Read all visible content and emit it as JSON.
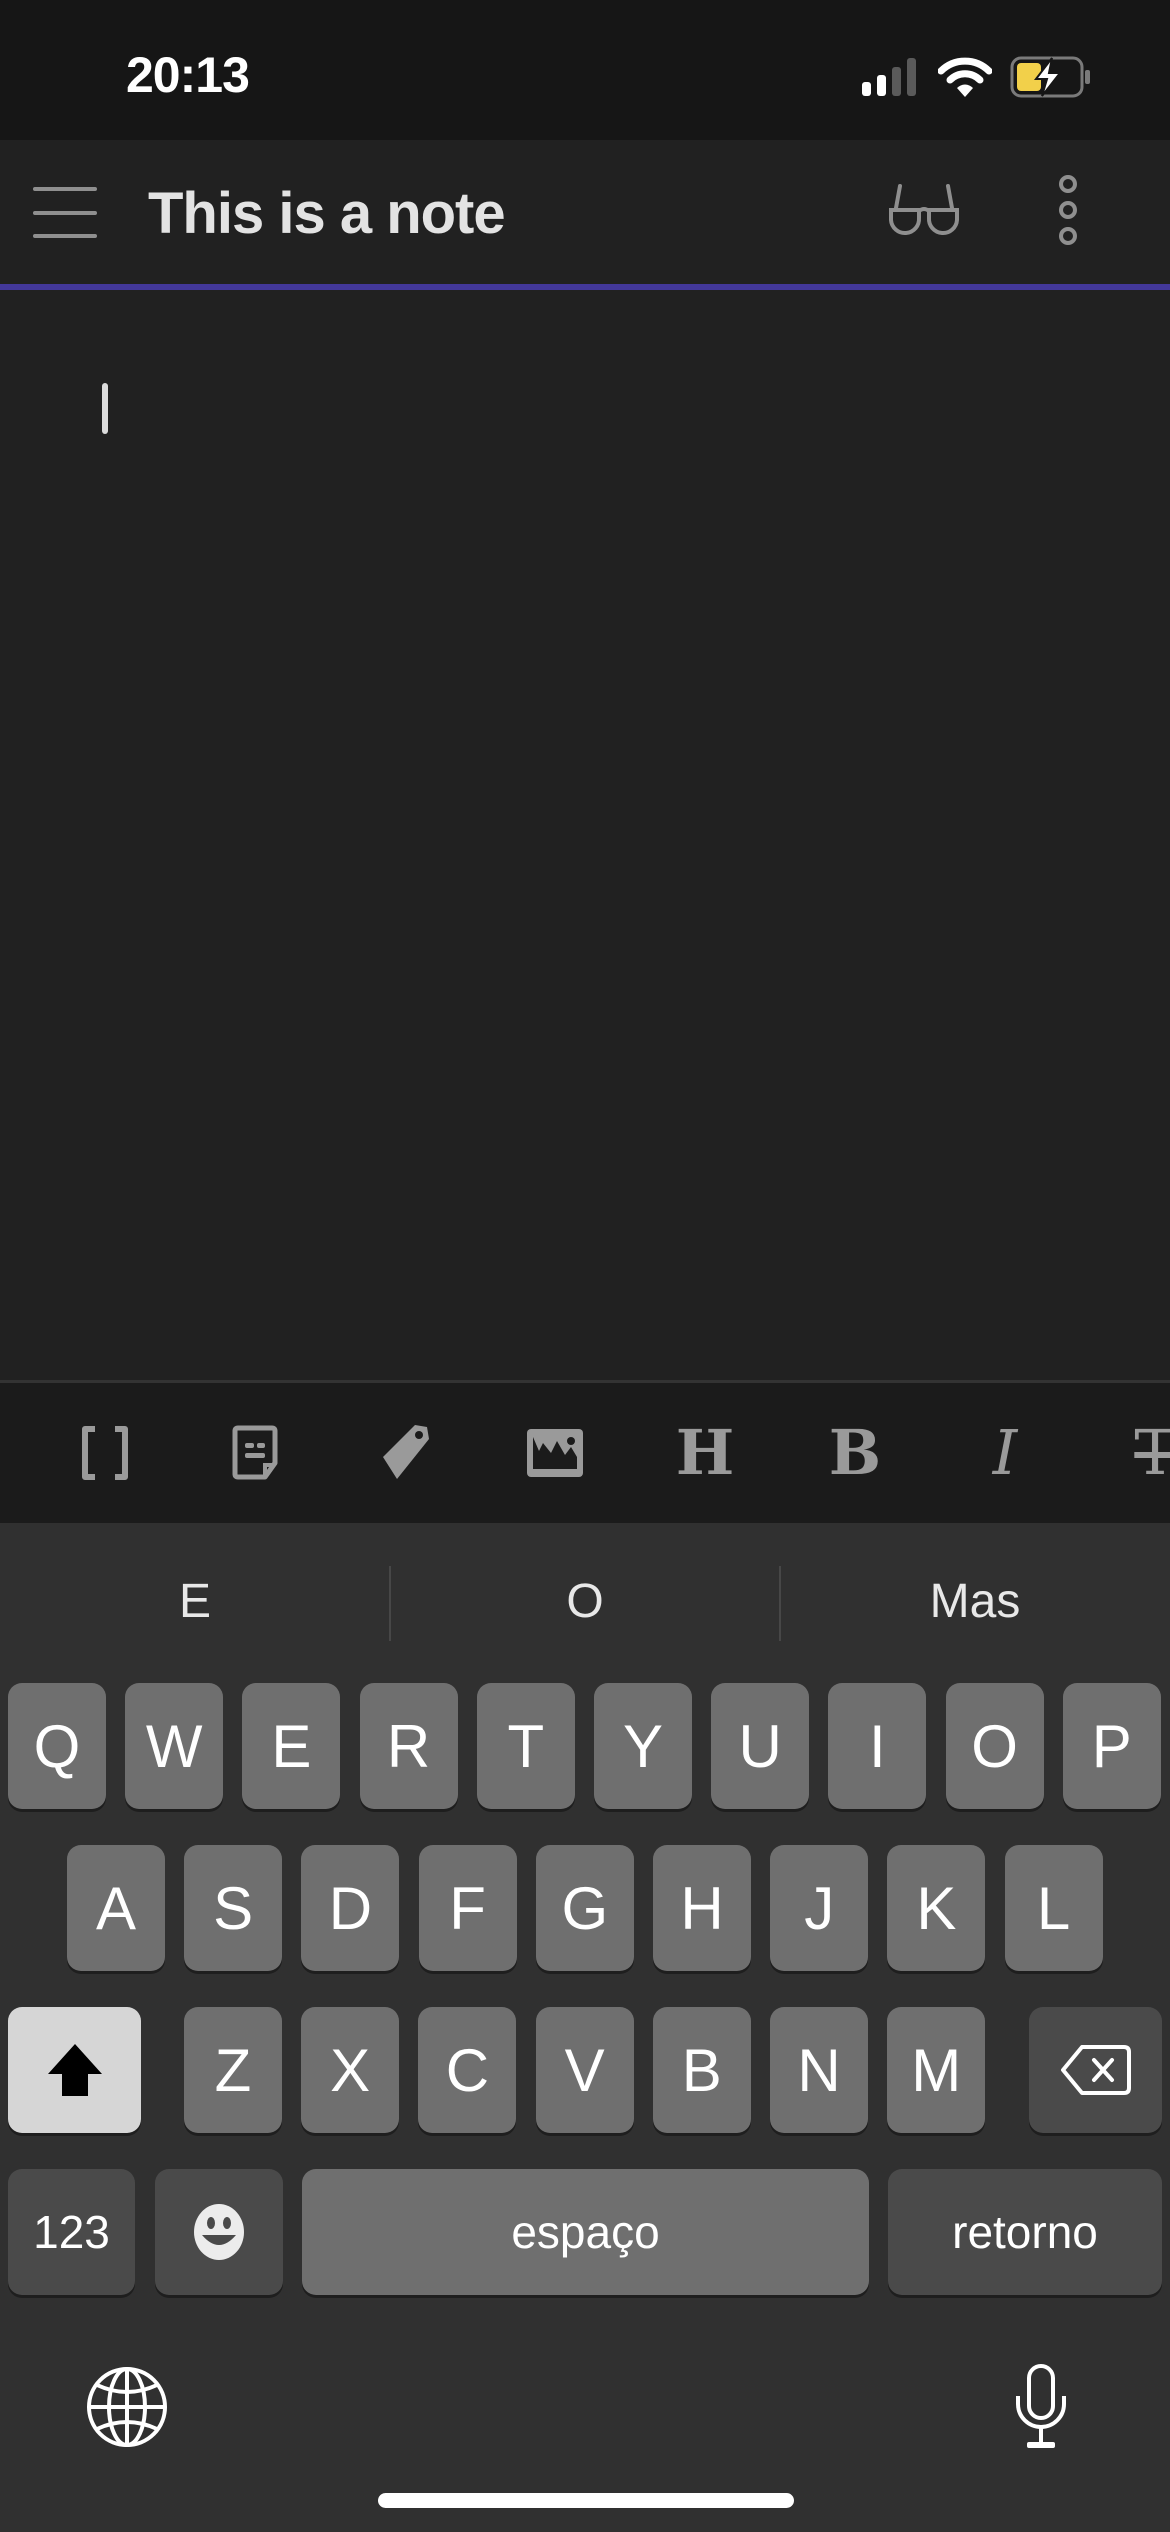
{
  "status_bar": {
    "time": "20:13",
    "signal_icon": "cellular-signal-icon",
    "wifi_icon": "wifi-icon",
    "battery_icon": "battery-charging-icon",
    "battery_color": "#f2d04a"
  },
  "header": {
    "menu_icon": "hamburger-menu-icon",
    "title": "This is a note",
    "reader_icon": "glasses-icon",
    "more_icon": "more-vertical-icon",
    "accent_color": "#43389a"
  },
  "editor": {
    "content": ""
  },
  "toolbar": {
    "items": [
      {
        "name": "brackets",
        "icon": "wikilink-brackets-icon"
      },
      {
        "name": "template",
        "icon": "note-template-icon"
      },
      {
        "name": "tag",
        "icon": "tag-icon"
      },
      {
        "name": "image",
        "icon": "image-icon"
      },
      {
        "name": "heading",
        "icon": "heading-icon",
        "glyph": "H"
      },
      {
        "name": "bold",
        "icon": "bold-icon",
        "glyph": "B"
      },
      {
        "name": "italic",
        "icon": "italic-icon",
        "glyph": "I"
      },
      {
        "name": "strikethrough",
        "icon": "strikethrough-icon",
        "glyph": "T"
      }
    ]
  },
  "keyboard": {
    "suggestions": [
      "E",
      "O",
      "Mas"
    ],
    "row1": [
      "Q",
      "W",
      "E",
      "R",
      "T",
      "Y",
      "U",
      "I",
      "O",
      "P"
    ],
    "row2": [
      "A",
      "S",
      "D",
      "F",
      "G",
      "H",
      "J",
      "K",
      "L"
    ],
    "row3": [
      "Z",
      "X",
      "C",
      "V",
      "B",
      "N",
      "M"
    ],
    "shift_icon": "shift-icon",
    "backspace_icon": "backspace-icon",
    "numbers_label": "123",
    "emoji_icon": "emoji-icon",
    "space_label": "espaço",
    "return_label": "retorno",
    "globe_icon": "globe-icon",
    "mic_icon": "microphone-icon"
  }
}
